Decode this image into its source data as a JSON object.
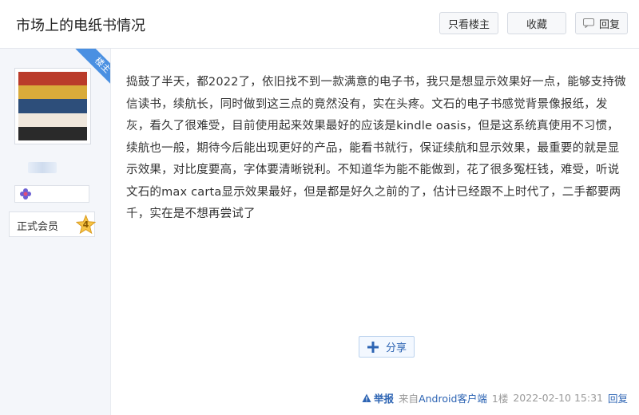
{
  "header": {
    "title": "市场上的电纸书情况",
    "only_op_label": "只看楼主",
    "favorite_label": "收藏",
    "reply_label": "回复"
  },
  "author": {
    "ribbon_label": "楼主",
    "member_label": "正式会员",
    "level": "4",
    "avatar_stripes": [
      "#ba3b2a",
      "#d9ab3a",
      "#2d4e7a",
      "#efe7dc",
      "#2a2a2a"
    ]
  },
  "post": {
    "content": "捣鼓了半天，都2022了，依旧找不到一款满意的电子书，我只是想显示效果好一点，能够支持微信读书，续航长，同时做到这三点的竟然没有，实在头疼。文石的电子书感觉背景像报纸，发灰，看久了很难受，目前使用起来效果最好的应该是kindle oasis，但是这系统真使用不习惯，续航也一般，期待今后能出现更好的产品，能看书就行，保证续航和显示效果，最重要的就是显示效果，对比度要高，字体要清晰锐利。不知道华为能不能做到，花了很多冤枉钱，难受，听说文石的max carta显示效果最好，但是都是好久之前的了，估计已经跟不上时代了，二手都要两千，实在是不想再尝试了"
  },
  "actions": {
    "share_label": "分享"
  },
  "footer": {
    "report_label": "举报",
    "source_prefix": "来自",
    "client_label": "Android客户端",
    "floor": "1楼",
    "datetime": "2022-02-10 15:31",
    "reply_label": "回复"
  },
  "colors": {
    "accent": "#2d64b3",
    "ribbon": "#4a90e2",
    "sidebar_bg": "#f4f6fa"
  }
}
